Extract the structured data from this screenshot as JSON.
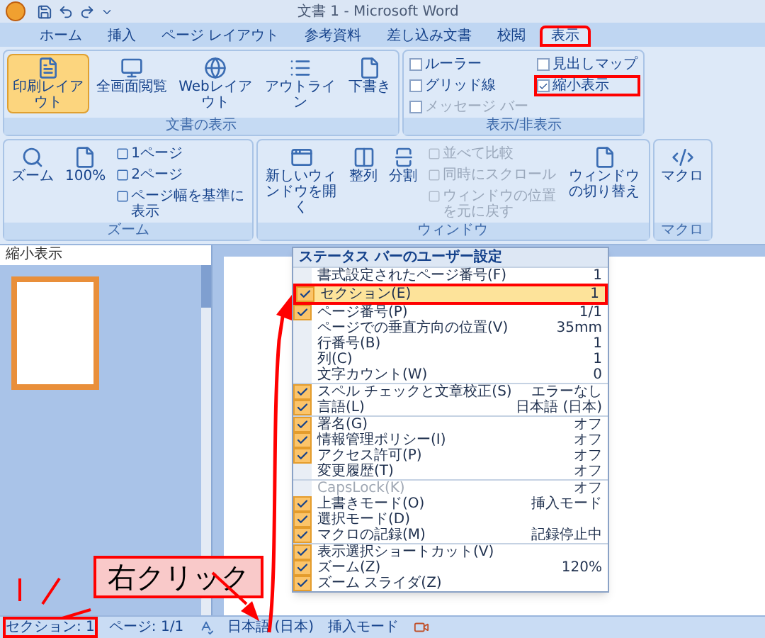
{
  "window": {
    "title": "文書 1 - Microsoft Word"
  },
  "tabs": [
    {
      "label": "ホーム",
      "selected": false,
      "annotated": false
    },
    {
      "label": "挿入",
      "selected": false,
      "annotated": false
    },
    {
      "label": "ページ レイアウト",
      "selected": false,
      "annotated": false
    },
    {
      "label": "参考資料",
      "selected": false,
      "annotated": false
    },
    {
      "label": "差し込み文書",
      "selected": false,
      "annotated": false
    },
    {
      "label": "校閲",
      "selected": false,
      "annotated": false
    },
    {
      "label": "表示",
      "selected": true,
      "annotated": true
    }
  ],
  "ribbon": {
    "groups": [
      {
        "label": "文書の表示",
        "items": [
          {
            "kind": "large",
            "label": "印刷レイアウト",
            "selected": true
          },
          {
            "kind": "large",
            "label": "全画面閲覧",
            "selected": false
          },
          {
            "kind": "large",
            "label": "Webレイアウト",
            "selected": false
          },
          {
            "kind": "large",
            "label": "アウトライン",
            "selected": false
          },
          {
            "kind": "large",
            "label": "下書き",
            "selected": false
          }
        ]
      },
      {
        "label": "表示/非表示",
        "items": [
          {
            "kind": "check",
            "label": "ルーラー",
            "checked": false,
            "disabled": false,
            "annotated": false
          },
          {
            "kind": "check",
            "label": "グリッド線",
            "checked": false,
            "disabled": false,
            "annotated": false
          },
          {
            "kind": "check",
            "label": "メッセージ バー",
            "checked": false,
            "disabled": true,
            "annotated": false
          },
          {
            "kind": "check",
            "label": "見出しマップ",
            "checked": false,
            "disabled": false,
            "annotated": false
          },
          {
            "kind": "check",
            "label": "縮小表示",
            "checked": true,
            "disabled": false,
            "annotated": true
          }
        ]
      },
      {
        "label": "ズーム",
        "items": [
          {
            "kind": "large",
            "label": "ズーム"
          },
          {
            "kind": "large",
            "label": "100%"
          },
          {
            "kind": "small",
            "label": "1ページ",
            "disabled": false
          },
          {
            "kind": "small",
            "label": "2ページ",
            "disabled": false
          },
          {
            "kind": "small",
            "label": "ページ幅を基準に表示",
            "disabled": false
          }
        ]
      },
      {
        "label": "ウィンドウ",
        "items": [
          {
            "kind": "large",
            "label": "新しいウィンドウを開く"
          },
          {
            "kind": "large",
            "label": "整列"
          },
          {
            "kind": "large",
            "label": "分割"
          },
          {
            "kind": "small",
            "label": "並べて比較",
            "disabled": true
          },
          {
            "kind": "small",
            "label": "同時にスクロール",
            "disabled": true
          },
          {
            "kind": "small",
            "label": "ウィンドウの位置を元に戻す",
            "disabled": true
          },
          {
            "kind": "large",
            "label": "ウィンドウの切り替え"
          }
        ]
      },
      {
        "label": "マクロ",
        "items": [
          {
            "kind": "large",
            "label": "マクロ"
          }
        ]
      }
    ]
  },
  "thumbnail_pane": {
    "title": "縮小表示"
  },
  "context_menu": {
    "title": "ステータス バーのユーザー設定",
    "sections": [
      {
        "items": [
          {
            "label": "書式設定されたページ番号(F)",
            "value": "1",
            "checked": false,
            "disabled": false,
            "selected": false,
            "annotated": false
          },
          {
            "label": "セクション(E)",
            "value": "1",
            "checked": true,
            "disabled": false,
            "selected": true,
            "annotated": true
          },
          {
            "label": "ページ番号(P)",
            "value": "1/1",
            "checked": true,
            "disabled": false,
            "selected": false,
            "annotated": false
          },
          {
            "label": "ページでの垂直方向の位置(V)",
            "value": "35mm",
            "checked": false,
            "disabled": false,
            "selected": false,
            "annotated": false
          },
          {
            "label": "行番号(B)",
            "value": "1",
            "checked": false,
            "disabled": false,
            "selected": false,
            "annotated": false
          },
          {
            "label": "列(C)",
            "value": "1",
            "checked": false,
            "disabled": false,
            "selected": false,
            "annotated": false
          },
          {
            "label": "文字カウント(W)",
            "value": "0",
            "checked": false,
            "disabled": false,
            "selected": false,
            "annotated": false
          }
        ]
      },
      {
        "items": [
          {
            "label": "スペル チェックと文章校正(S)",
            "value": "エラーなし",
            "checked": true,
            "disabled": false,
            "selected": false,
            "annotated": false
          },
          {
            "label": "言語(L)",
            "value": "日本語 (日本)",
            "checked": true,
            "disabled": false,
            "selected": false,
            "annotated": false
          }
        ]
      },
      {
        "items": [
          {
            "label": "署名(G)",
            "value": "オフ",
            "checked": true,
            "disabled": false,
            "selected": false,
            "annotated": false
          },
          {
            "label": "情報管理ポリシー(I)",
            "value": "オフ",
            "checked": true,
            "disabled": false,
            "selected": false,
            "annotated": false
          },
          {
            "label": "アクセス許可(P)",
            "value": "オフ",
            "checked": true,
            "disabled": false,
            "selected": false,
            "annotated": false
          },
          {
            "label": "変更履歴(T)",
            "value": "オフ",
            "checked": false,
            "disabled": false,
            "selected": false,
            "annotated": false
          }
        ]
      },
      {
        "items": [
          {
            "label": "CapsLock(K)",
            "value": "オフ",
            "checked": false,
            "disabled": true,
            "selected": false,
            "annotated": false
          },
          {
            "label": "上書きモード(O)",
            "value": "挿入モード",
            "checked": true,
            "disabled": false,
            "selected": false,
            "annotated": false
          },
          {
            "label": "選択モード(D)",
            "checked": true,
            "disabled": false,
            "selected": false,
            "annotated": false
          },
          {
            "label": "マクロの記録(M)",
            "value": "記録停止中",
            "checked": true,
            "disabled": false,
            "selected": false,
            "annotated": false
          }
        ]
      },
      {
        "items": [
          {
            "label": "表示選択ショートカット(V)",
            "checked": true,
            "disabled": false,
            "selected": false,
            "annotated": false
          },
          {
            "label": "ズーム(Z)",
            "value": "120%",
            "checked": true,
            "disabled": false,
            "selected": false,
            "annotated": false
          },
          {
            "label": "ズーム スライダ(Z)",
            "checked": true,
            "disabled": false,
            "selected": false,
            "annotated": false
          }
        ]
      }
    ]
  },
  "status_bar": {
    "items": [
      {
        "kind": "text",
        "label": "セクション: 1",
        "annotated": true
      },
      {
        "kind": "text",
        "label": "ページ: 1/1",
        "annotated": false
      },
      {
        "kind": "spell-icon",
        "annotated": false
      },
      {
        "kind": "text",
        "label": "日本語 (日本)",
        "annotated": false
      },
      {
        "kind": "text",
        "label": "挿入モード",
        "annotated": false
      },
      {
        "kind": "macro-icon",
        "annotated": false
      }
    ]
  },
  "callout": {
    "label": "右クリック"
  }
}
